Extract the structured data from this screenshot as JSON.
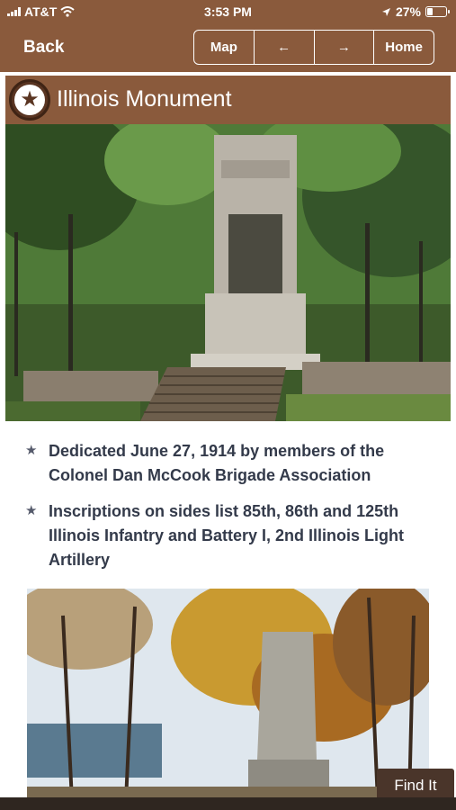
{
  "status": {
    "carrier": "AT&T",
    "time": "3:53 PM",
    "battery": "27%"
  },
  "nav": {
    "back": "Back",
    "map": "Map",
    "prev": "←",
    "next": "→",
    "home": "Home"
  },
  "header": {
    "title": "Illinois Monument",
    "icon": "star-icon"
  },
  "bullets": [
    "Dedicated June 27, 1914 by members of the Colonel Dan McCook Brigade Association",
    "Inscriptions on sides list 85th, 86th and 125th Illinois Infantry and Battery I, 2nd Illinois Light Artillery"
  ],
  "find_button": "Find It",
  "colors": {
    "brand_brown": "#8a5a3c",
    "text": "#333a4a"
  }
}
